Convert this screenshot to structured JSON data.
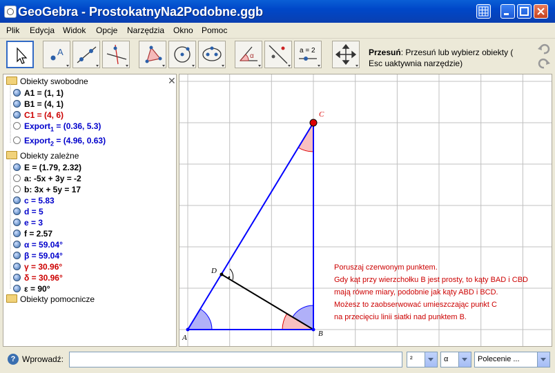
{
  "window": {
    "title": "GeoGebra - ProstokatnyNa2Podobne.ggb"
  },
  "menu": [
    "Plik",
    "Edycja",
    "Widok",
    "Opcje",
    "Narzędzia",
    "Okno",
    "Pomoc"
  ],
  "toolbar": {
    "help_bold": "Przesuń",
    "help_text": ": Przesuń lub wybierz obiekty ( Esc uaktywnia narzędzie)",
    "tools": [
      "move-tool",
      "point-tool",
      "line-tool",
      "perpendicular-tool",
      "polygon-tool",
      "circle-tool",
      "conic-tool",
      "angle-tool",
      "reflect-tool",
      "slider-tool",
      "move-view-tool"
    ],
    "slider_label": "a = 2"
  },
  "algebra": {
    "free_header": "Obiekty swobodne",
    "dependent_header": "Obiekty zależne",
    "auxiliary_header": "Obiekty pomocnicze",
    "free": [
      {
        "text": "A1 = (1, 1)",
        "color": "black",
        "dot": "filled"
      },
      {
        "text": "B1 = (4, 1)",
        "color": "black",
        "dot": "filled"
      },
      {
        "text": "C1 = (4, 6)",
        "color": "red",
        "dot": "filled"
      },
      {
        "pre": "Export",
        "sub": "1",
        "post": " = (0.36, 5.3)",
        "color": "blue",
        "dot": "empty"
      },
      {
        "pre": "Export",
        "sub": "2",
        "post": " = (4.96, 0.63)",
        "color": "blue",
        "dot": "empty"
      }
    ],
    "dependent": [
      {
        "text": "E = (1.79, 2.32)",
        "color": "black",
        "dot": "filled"
      },
      {
        "text": "a: -5x + 3y = -2",
        "color": "black",
        "dot": "empty"
      },
      {
        "text": "b: 3x + 5y = 17",
        "color": "black",
        "dot": "empty"
      },
      {
        "text": "c = 5.83",
        "color": "blue",
        "dot": "filled"
      },
      {
        "text": "d = 5",
        "color": "blue",
        "dot": "filled"
      },
      {
        "text": "e = 3",
        "color": "blue",
        "dot": "filled"
      },
      {
        "text": "f = 2.57",
        "color": "black",
        "dot": "filled"
      },
      {
        "text": "α = 59.04°",
        "color": "blue",
        "dot": "filled"
      },
      {
        "text": "β = 59.04°",
        "color": "blue",
        "dot": "filled"
      },
      {
        "text": "γ = 30.96°",
        "color": "red",
        "dot": "filled"
      },
      {
        "text": "δ = 30.96°",
        "color": "red",
        "dot": "filled"
      },
      {
        "text": "ε = 90°",
        "color": "black",
        "dot": "filled"
      }
    ]
  },
  "graphics": {
    "labels": {
      "A": "A",
      "B": "B",
      "C": "C",
      "D": "D"
    },
    "note": [
      "Poruszaj czerwonym punktem.",
      "Gdy kąt przy wierzchołku B jest prosty, to kąty BAD i CBD",
      "mają równe miary, podobnie jak kąty ABD i BCD.",
      "Możesz to zaobserwować umieszczając punkt C",
      "na przecięciu linii siatki nad punktem B."
    ],
    "colors": {
      "triangle": "#0000ff",
      "red_point": "#dd0000",
      "angle_blue": "#b0b0f8",
      "angle_red": "#f8c0c0",
      "note": "#cc0000"
    }
  },
  "inputbar": {
    "label": "Wprowadź:",
    "value": "",
    "combo1": "²",
    "combo2": "α",
    "combo3": "Polecenie ..."
  }
}
